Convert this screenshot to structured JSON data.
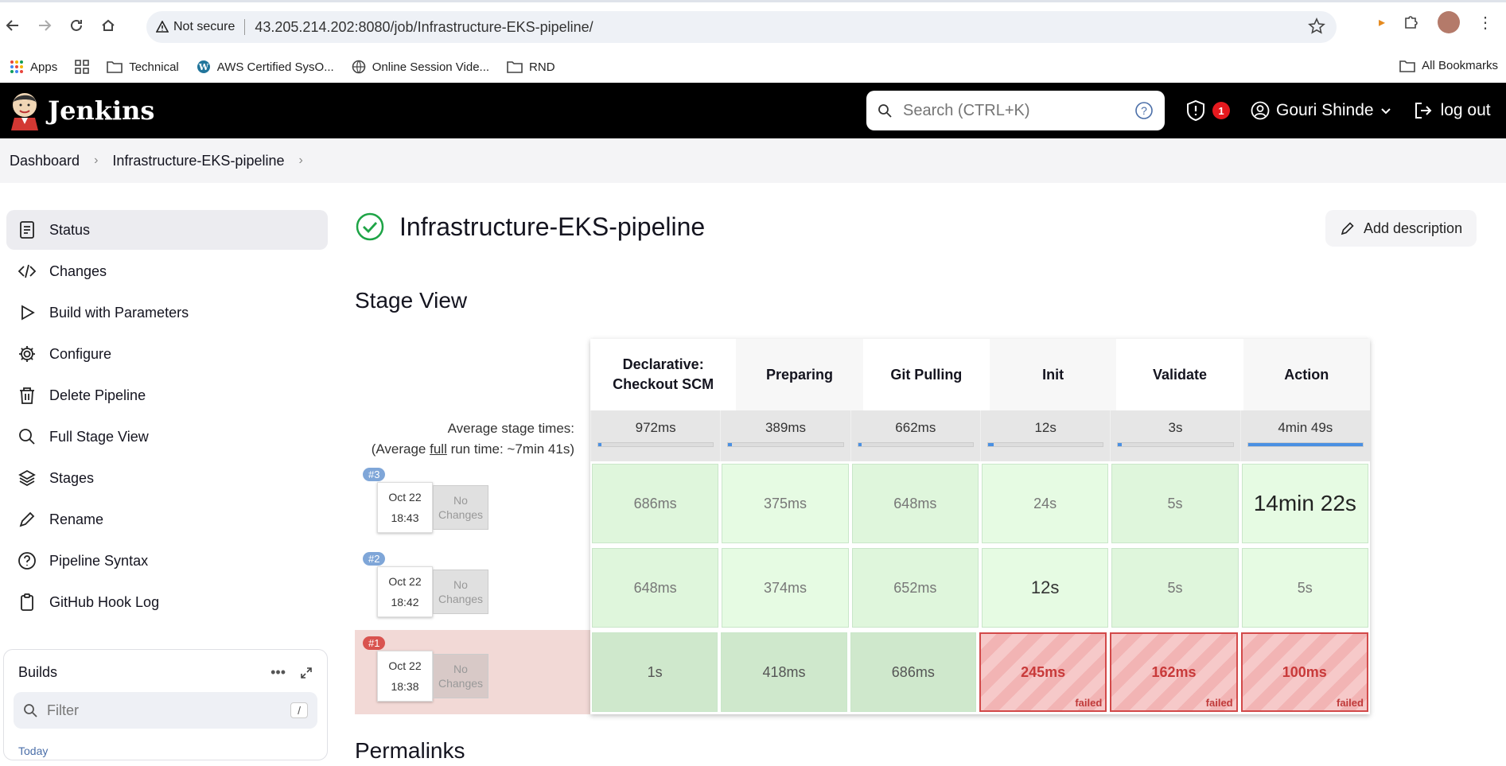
{
  "browser": {
    "not_secure_label": "Not secure",
    "url": "43.205.214.202:8080/job/Infrastructure-EKS-pipeline/",
    "bookmarks": [
      {
        "label": "Apps",
        "icon": "apps-grid-icon"
      },
      {
        "label": "",
        "icon": "grid-icon"
      },
      {
        "label": "Technical",
        "icon": "folder-icon"
      },
      {
        "label": "AWS Certified SysO...",
        "icon": "wordpress-icon"
      },
      {
        "label": "Online Session Vide...",
        "icon": "globe-icon"
      },
      {
        "label": "RND",
        "icon": "folder-icon"
      }
    ],
    "all_bookmarks_label": "All Bookmarks"
  },
  "header": {
    "logo_text": "Jenkins",
    "search_placeholder": "Search (CTRL+K)",
    "security_count": "1",
    "user_name": "Gouri Shinde",
    "logout_label": "log out"
  },
  "breadcrumb": [
    "Dashboard",
    "Infrastructure-EKS-pipeline"
  ],
  "sidebar": {
    "items": [
      {
        "label": "Status",
        "icon": "status-icon",
        "active": true
      },
      {
        "label": "Changes",
        "icon": "code-icon"
      },
      {
        "label": "Build with Parameters",
        "icon": "play-icon"
      },
      {
        "label": "Configure",
        "icon": "gear-icon"
      },
      {
        "label": "Delete Pipeline",
        "icon": "trash-icon"
      },
      {
        "label": "Full Stage View",
        "icon": "search-icon"
      },
      {
        "label": "Stages",
        "icon": "layers-icon"
      },
      {
        "label": "Rename",
        "icon": "pencil-icon"
      },
      {
        "label": "Pipeline Syntax",
        "icon": "help-icon"
      },
      {
        "label": "GitHub Hook Log",
        "icon": "clipboard-icon"
      }
    ]
  },
  "builds_panel": {
    "title": "Builds",
    "filter_placeholder": "Filter",
    "kbd": "/",
    "today_label": "Today"
  },
  "page": {
    "title": "Infrastructure-EKS-pipeline",
    "add_description_label": "Add description",
    "stage_view_title": "Stage View",
    "permalinks_title": "Permalinks"
  },
  "stage_view": {
    "avg_label_line1": "Average stage times:",
    "avg_label_prefix": "(Average ",
    "avg_label_link": "full",
    "avg_label_suffix": " run time: ~7min 41s)",
    "stages": [
      {
        "name": "Declarative: Checkout SCM",
        "avg": "972ms",
        "avg_fraction": 0.01
      },
      {
        "name": "Preparing",
        "avg": "389ms",
        "avg_fraction": 0.005
      },
      {
        "name": "Git Pulling",
        "avg": "662ms",
        "avg_fraction": 0.008
      },
      {
        "name": "Init",
        "avg": "12s",
        "avg_fraction": 0.05
      },
      {
        "name": "Validate",
        "avg": "3s",
        "avg_fraction": 0.02
      },
      {
        "name": "Action",
        "avg": "4min 49s",
        "avg_fraction": 1.0
      }
    ],
    "runs": [
      {
        "number": "#3",
        "date": "Oct 22",
        "time": "18:43",
        "changes": "No Changes",
        "failed": false,
        "cells": [
          "686ms",
          "375ms",
          "648ms",
          "24s",
          "5s",
          "14min 22s"
        ]
      },
      {
        "number": "#2",
        "date": "Oct 22",
        "time": "18:42",
        "changes": "No Changes",
        "failed": false,
        "cells": [
          "648ms",
          "374ms",
          "652ms",
          "12s",
          "5s",
          "5s"
        ]
      },
      {
        "number": "#1",
        "date": "Oct 22",
        "time": "18:38",
        "changes": "No Changes",
        "failed": true,
        "cells": [
          "1s",
          "418ms",
          "686ms",
          "245ms",
          "162ms",
          "100ms"
        ],
        "failed_label": "failed"
      }
    ]
  }
}
